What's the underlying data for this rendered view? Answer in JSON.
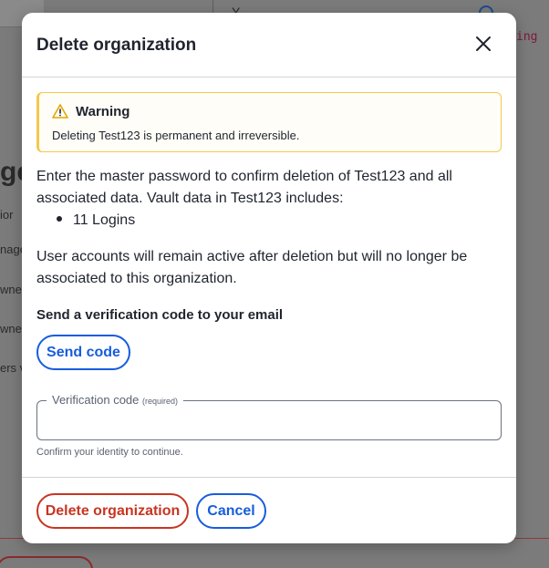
{
  "background": {
    "heading_fragment": "ge",
    "lines": [
      "ior",
      "nage",
      "wne",
      "wne",
      "ers v"
    ],
    "right_text": "ing",
    "top_text": "Y"
  },
  "dialog": {
    "title": "Delete organization",
    "close_label": "Close",
    "warning": {
      "title": "Warning",
      "text": "Deleting Test123 is permanent and irreversible."
    },
    "intro": "Enter the master password to confirm deletion of Test123 and all associated data. Vault data in Test123 includes:",
    "vault_items": [
      "11 Logins"
    ],
    "note": "User accounts will remain active after deletion but will no longer be associated to this organization.",
    "verification_section_label": "Send a verification code to your email",
    "send_code_label": "Send code",
    "field": {
      "label": "Verification code",
      "required_tag": "(required)",
      "value": "",
      "hint": "Confirm your identity to continue."
    },
    "delete_label": "Delete organization",
    "cancel_label": "Cancel"
  },
  "colors": {
    "primary": "#175ddc",
    "danger": "#c83522",
    "warning": "#f2c94c"
  }
}
